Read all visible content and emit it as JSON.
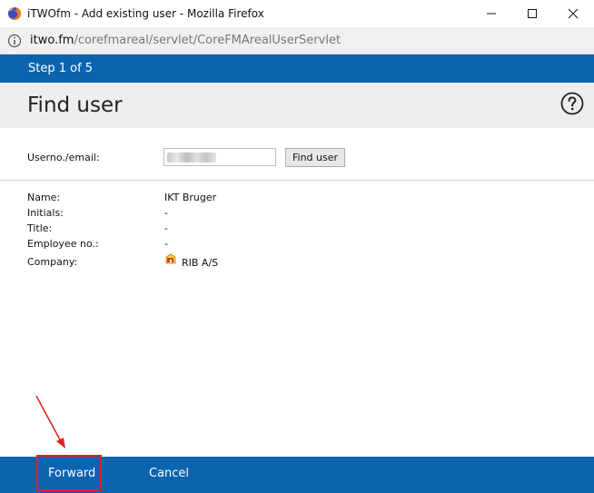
{
  "window": {
    "title": "iTWOfm - Add existing user - Mozilla Firefox"
  },
  "urlbar": {
    "host": "itwo.fm",
    "path": "/corefmareal/servlet/CoreFMArealUserServlet"
  },
  "wizard": {
    "step": "Step 1 of 5",
    "title": "Find user"
  },
  "search": {
    "label": "Userno./email:",
    "button": "Find user"
  },
  "details": {
    "name_label": "Name:",
    "name_value": "IKT Bruger",
    "initials_label": "Initials:",
    "initials_value": "-",
    "title_label": "Title:",
    "title_value": "-",
    "employee_label": "Employee no.:",
    "employee_value": "-",
    "company_label": "Company:",
    "company_value": "RIB A/S"
  },
  "footer": {
    "forward": "Forward",
    "cancel": "Cancel"
  },
  "colors": {
    "accent": "#0c63b0",
    "header_bg": "#eeeeee",
    "annotation": "#e02020"
  },
  "icons": [
    "firefox-icon",
    "minimize-icon",
    "maximize-icon",
    "close-icon",
    "info-icon",
    "help-icon",
    "company-icon"
  ]
}
